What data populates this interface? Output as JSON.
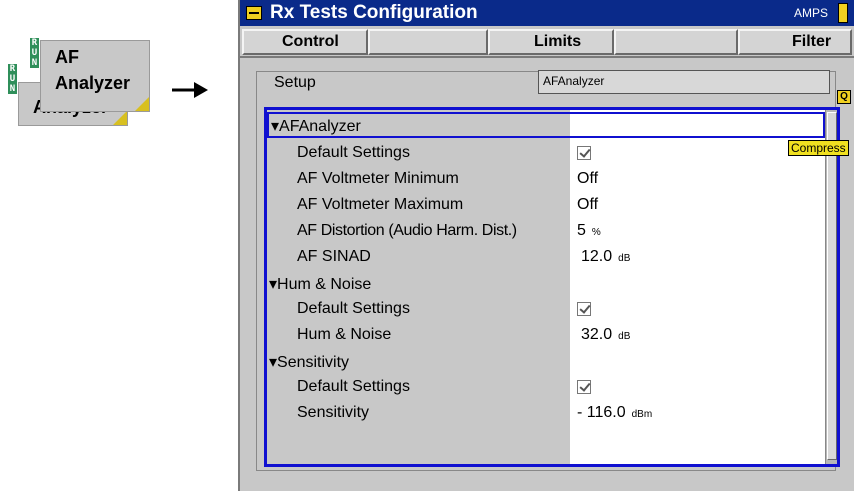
{
  "softkeys": {
    "back": {
      "label": "Analyzer",
      "run": [
        "R",
        "U",
        "N"
      ]
    },
    "front": {
      "line1": "AF",
      "line2": "Analyzer",
      "run": [
        "R",
        "U",
        "N"
      ]
    }
  },
  "window": {
    "title": "Rx Tests Configuration",
    "standard": "AMPS",
    "tabs": [
      "Control",
      "",
      "Limits",
      "",
      "Filter"
    ],
    "setup_label": "Setup",
    "setup_field": "AFAnalyzer",
    "q_icon": "Q",
    "compress_label": "Compress"
  },
  "rows": [
    {
      "name": "AFAnalyzer",
      "group": true,
      "selected": true,
      "value": "",
      "unit": ""
    },
    {
      "name": "Default Settings",
      "value": "",
      "check": true,
      "unit": ""
    },
    {
      "name": "AF Voltmeter Minimum",
      "value": "Off",
      "unit": ""
    },
    {
      "name": "AF Voltmeter Maximum",
      "value": "Off",
      "unit": ""
    },
    {
      "name": "AF Distortion (Audio Harm. Dist.)",
      "value": "5",
      "unit": "%"
    },
    {
      "name": "AF SINAD",
      "value": "12.0",
      "unit": "dB"
    },
    {
      "name": "Hum & Noise",
      "group": true,
      "value": "",
      "unit": ""
    },
    {
      "name": "Default Settings",
      "value": "",
      "check": true,
      "unit": ""
    },
    {
      "name": "Hum & Noise",
      "value": "32.0",
      "unit": "dB"
    },
    {
      "name": "Sensitivity",
      "group": true,
      "value": "",
      "unit": ""
    },
    {
      "name": "Default Settings",
      "value": "",
      "check": true,
      "unit": ""
    },
    {
      "name": "Sensitivity",
      "value": "- 116.0",
      "unit": "dBm"
    }
  ]
}
